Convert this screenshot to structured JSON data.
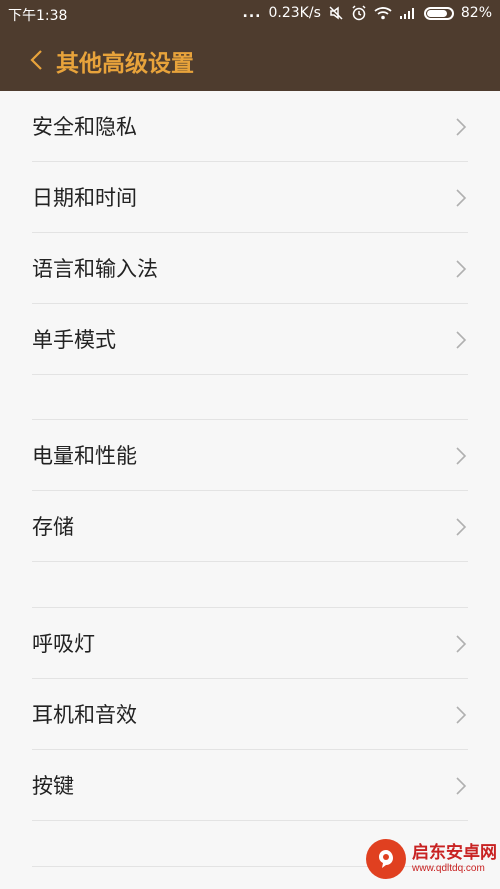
{
  "status_bar": {
    "time": "下午1:38",
    "dots": "...",
    "speed": "0.23K/s",
    "battery_text": "82%",
    "battery_level": 0.82
  },
  "header": {
    "title": "其他高级设置"
  },
  "groups": [
    {
      "items": [
        {
          "label": "安全和隐私"
        },
        {
          "label": "日期和时间"
        },
        {
          "label": "语言和输入法"
        },
        {
          "label": "单手模式"
        }
      ]
    },
    {
      "items": [
        {
          "label": "电量和性能"
        },
        {
          "label": "存储"
        }
      ]
    },
    {
      "items": [
        {
          "label": "呼吸灯"
        },
        {
          "label": "耳机和音效"
        },
        {
          "label": "按键"
        }
      ]
    }
  ],
  "watermark": {
    "main": "启东安卓网",
    "sub": "www.qdltdq.com"
  },
  "colors": {
    "header_bg": "#4e3c2e",
    "title_accent": "#e8a33b",
    "page_bg": "#f7f7f7"
  }
}
